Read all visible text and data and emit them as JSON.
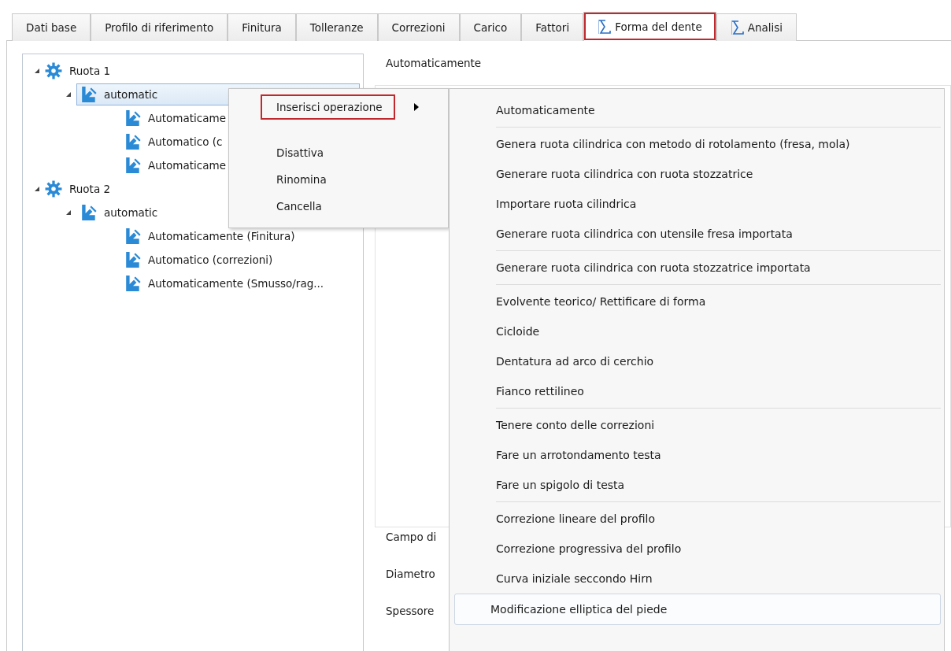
{
  "tabs": [
    {
      "label": "Dati base",
      "kind": "plain",
      "selected": false
    },
    {
      "label": "Profilo di riferimento",
      "kind": "plain",
      "selected": false
    },
    {
      "label": "Finitura",
      "kind": "plain",
      "selected": false
    },
    {
      "label": "Tolleranze",
      "kind": "plain",
      "selected": false
    },
    {
      "label": "Correzioni",
      "kind": "plain",
      "selected": false
    },
    {
      "label": "Carico",
      "kind": "plain",
      "selected": false
    },
    {
      "label": "Fattori",
      "kind": "plain",
      "selected": false
    },
    {
      "label": "Forma del dente",
      "kind": "sigma",
      "selected": true
    },
    {
      "label": "Analisi",
      "kind": "sigma",
      "selected": false
    }
  ],
  "tree": [
    {
      "label": "Ruota 1",
      "kind": "wheel",
      "expanded": true,
      "children": [
        {
          "label": "automatic",
          "kind": "operation",
          "expanded": true,
          "selected": true,
          "children": [
            {
              "label": "Automaticame",
              "kind": "operation",
              "selected": false
            },
            {
              "label": "Automatico (c",
              "kind": "operation",
              "selected": false
            },
            {
              "label": "Automaticame",
              "kind": "operation",
              "selected": false
            }
          ]
        }
      ]
    },
    {
      "label": "Ruota 2",
      "kind": "wheel",
      "expanded": true,
      "children": [
        {
          "label": "automatic",
          "kind": "operation",
          "expanded": true,
          "selected": false,
          "children": [
            {
              "label": "Automaticamente (Finitura)",
              "kind": "operation",
              "selected": false
            },
            {
              "label": "Automatico (correzioni)",
              "kind": "operation",
              "selected": false
            },
            {
              "label": "Automaticamente (Smusso/rag...",
              "kind": "operation",
              "selected": false
            }
          ]
        }
      ]
    }
  ],
  "detail": {
    "heading": "Automaticamente",
    "fields": [
      "Campo di",
      "Diametro",
      "Spessore"
    ]
  },
  "context_menu": {
    "items": [
      {
        "label": "Inserisci operazione",
        "submenu": true,
        "selected": true
      },
      {
        "label": "Disattiva",
        "submenu": false,
        "selected": false
      },
      {
        "label": "Rinomina",
        "submenu": false,
        "selected": false
      },
      {
        "label": "Cancella",
        "submenu": false,
        "selected": false
      }
    ]
  },
  "submenu": {
    "groups": [
      [
        {
          "label": "Automaticamente",
          "selected": false
        }
      ],
      [
        {
          "label": "Genera ruota cilindrica con metodo di rotolamento (fresa, mola)",
          "selected": false
        },
        {
          "label": "Generare ruota cilindrica con ruota stozzatrice",
          "selected": false
        },
        {
          "label": "Importare ruota cilindrica",
          "selected": false
        },
        {
          "label": "Generare ruota cilindrica con utensile fresa importata",
          "selected": false
        }
      ],
      [
        {
          "label": "Generare ruota cilindrica con ruota stozzatrice importata",
          "selected": false
        }
      ],
      [
        {
          "label": "Evolvente teorico/ Rettificare di forma",
          "selected": false
        },
        {
          "label": "Cicloide",
          "selected": false
        },
        {
          "label": "Dentatura ad arco di cerchio",
          "selected": false
        },
        {
          "label": "Fianco rettilineo",
          "selected": false
        }
      ],
      [
        {
          "label": "Tenere conto delle correzioni",
          "selected": false
        },
        {
          "label": "Fare un arrotondamento testa",
          "selected": false
        },
        {
          "label": "Fare un spigolo di testa",
          "selected": false
        }
      ],
      [
        {
          "label": "Correzione lineare del profilo",
          "selected": false
        },
        {
          "label": "Correzione progressiva del profilo",
          "selected": false
        },
        {
          "label": "Curva iniziale seccondo Hirn",
          "selected": false
        },
        {
          "label": "Modificazione elliptica del piede",
          "selected": true
        }
      ]
    ]
  }
}
